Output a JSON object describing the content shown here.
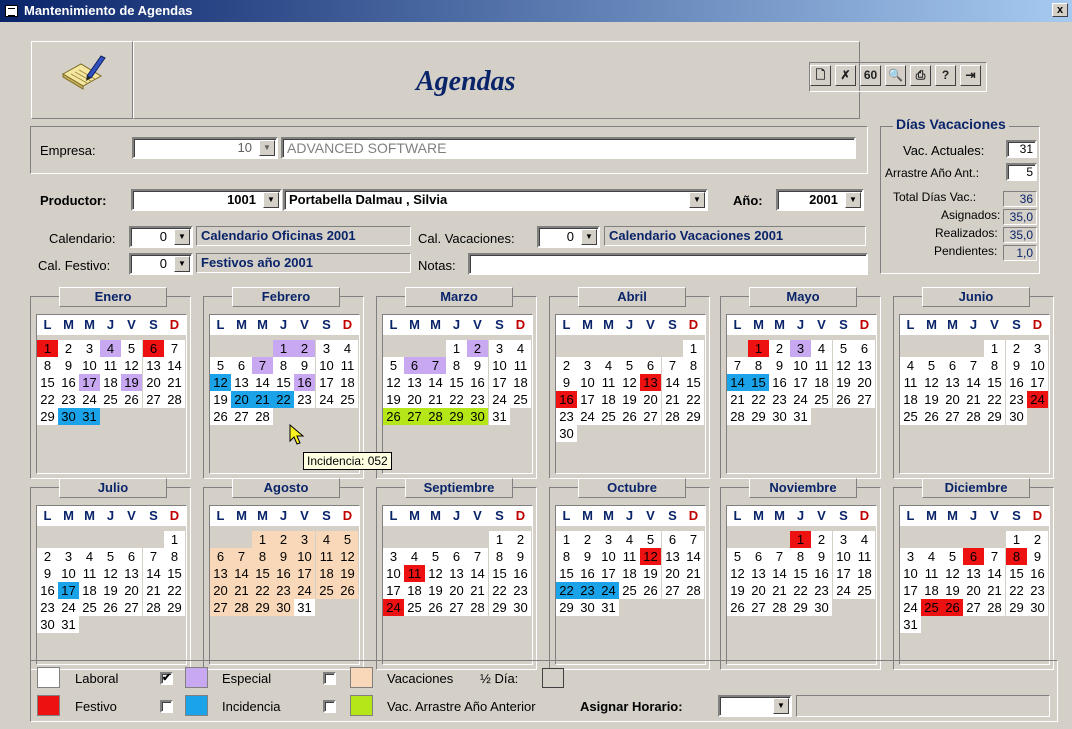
{
  "window": {
    "title": "Mantenimiento de Agendas",
    "close": "x"
  },
  "header": {
    "title": "Agendas"
  },
  "toolbar": [
    {
      "icon": "new-document-icon",
      "glyph": "🗋"
    },
    {
      "icon": "delete-icon",
      "glyph": "✗"
    },
    {
      "icon": "find-icon",
      "glyph": "60"
    },
    {
      "icon": "preview-icon",
      "glyph": "🔍"
    },
    {
      "icon": "print-icon",
      "glyph": "⎙"
    },
    {
      "icon": "help-icon",
      "glyph": "?"
    },
    {
      "icon": "exit-icon",
      "glyph": "⇥"
    }
  ],
  "form": {
    "empresa_label": "Empresa:",
    "empresa_code": "10",
    "empresa_name": "ADVANCED SOFTWARE",
    "productor_label": "Productor:",
    "productor_code": "1001",
    "productor_name": "Portabella Dalmau , Silvia",
    "anio_label": "Año:",
    "anio_value": "2001",
    "calendario_label": "Calendario:",
    "calendario_code": "0",
    "calendario_name": "Calendario Oficinas 2001",
    "cal_vacaciones_label": "Cal. Vacaciones:",
    "cal_vacaciones_code": "0",
    "cal_vacaciones_name": "Calendario Vacaciones 2001",
    "cal_festivo_label": "Cal. Festivo:",
    "cal_festivo_code": "0",
    "cal_festivo_name": "Festivos año 2001",
    "notas_label": "Notas:",
    "notas_value": ""
  },
  "vacaciones": {
    "title": "Días Vacaciones",
    "actuales_label": "Vac. Actuales:",
    "actuales": "31",
    "arrastre_label": "Arrastre Año Ant.:",
    "arrastre": "5",
    "total_label": "Total Días Vac.:",
    "total": "36",
    "asignados_label": "Asignados:",
    "asignados": "35,0",
    "realizados_label": "Realizados:",
    "realizados": "35,0",
    "pendientes_label": "Pendientes:",
    "pendientes": "1,0"
  },
  "weekdays": [
    "L",
    "M",
    "M",
    "J",
    "V",
    "S",
    "D"
  ],
  "months": [
    {
      "name": "Enero",
      "offset": 0,
      "days": 31,
      "marks": {
        "1": "festivo",
        "4": "especial",
        "6": "festivo",
        "17": "especial",
        "19": "especial",
        "30": "incidencia",
        "31": "incidencia"
      }
    },
    {
      "name": "Febrero",
      "offset": 3,
      "days": 28,
      "marks": {
        "1": "especial",
        "2": "especial",
        "7": "especial",
        "12": "incidencia",
        "16": "especial",
        "20": "incidencia",
        "21": "incidencia",
        "22": "incidencia"
      }
    },
    {
      "name": "Marzo",
      "offset": 3,
      "days": 31,
      "marks": {
        "2": "especial",
        "6": "especial",
        "7": "especial",
        "26": "arrastre",
        "27": "arrastre",
        "28": "arrastre",
        "29": "arrastre",
        "30": "arrastre"
      }
    },
    {
      "name": "Abril",
      "offset": 6,
      "days": 30,
      "marks": {
        "13": "festivo",
        "16": "festivo"
      }
    },
    {
      "name": "Mayo",
      "offset": 1,
      "days": 31,
      "marks": {
        "1": "festivo",
        "3": "especial",
        "14": "incidencia",
        "15": "incidencia"
      }
    },
    {
      "name": "Junio",
      "offset": 4,
      "days": 30,
      "marks": {
        "24": "festivo"
      }
    },
    {
      "name": "Julio",
      "offset": 6,
      "days": 31,
      "marks": {
        "17": "incidencia"
      }
    },
    {
      "name": "Agosto",
      "offset": 2,
      "days": 31,
      "marks": {
        "1": "vacaciones",
        "2": "vacaciones",
        "3": "vacaciones",
        "4": "vacaciones",
        "5": "vacaciones",
        "6": "vacaciones",
        "7": "vacaciones",
        "8": "vacaciones",
        "9": "vacaciones",
        "10": "vacaciones",
        "11": "vacaciones",
        "12": "vacaciones",
        "13": "vacaciones",
        "14": "vacaciones",
        "15": "vacaciones",
        "16": "vacaciones",
        "17": "vacaciones",
        "18": "vacaciones",
        "19": "vacaciones",
        "20": "vacaciones",
        "21": "vacaciones",
        "22": "vacaciones",
        "23": "vacaciones",
        "24": "vacaciones",
        "25": "vacaciones",
        "26": "vacaciones",
        "27": "vacaciones",
        "28": "vacaciones",
        "29": "vacaciones",
        "30": "vacaciones"
      }
    },
    {
      "name": "Septiembre",
      "offset": 5,
      "days": 30,
      "marks": {
        "11": "festivo",
        "24": "festivo"
      }
    },
    {
      "name": "Octubre",
      "offset": 0,
      "days": 31,
      "marks": {
        "12": "festivo",
        "22": "incidencia",
        "23": "incidencia",
        "24": "incidencia"
      }
    },
    {
      "name": "Noviembre",
      "offset": 3,
      "days": 30,
      "marks": {
        "1": "festivo"
      }
    },
    {
      "name": "Diciembre",
      "offset": 5,
      "days": 31,
      "marks": {
        "6": "festivo",
        "8": "festivo",
        "25": "festivo",
        "26": "festivo"
      }
    }
  ],
  "tooltip": "Incidencia: 052",
  "legend": {
    "laboral": "Laboral",
    "festivo": "Festivo",
    "especial": "Especial",
    "incidencia": "Incidencia",
    "vacaciones": "Vacaciones",
    "medio_dia": "½ Día:",
    "arrastre": "Vac. Arrastre Año Anterior",
    "asignar_horario": "Asignar Horario:",
    "checks": {
      "especial": true,
      "incidencia": false,
      "vacaciones": false,
      "arrastre": false
    },
    "colors": {
      "laboral": "#ffffff",
      "festivo": "#ee1111",
      "especial": "#c8a8f0",
      "incidencia": "#1aa3e8",
      "vacaciones": "#f8d8b8",
      "arrastre": "#b4e618"
    }
  }
}
